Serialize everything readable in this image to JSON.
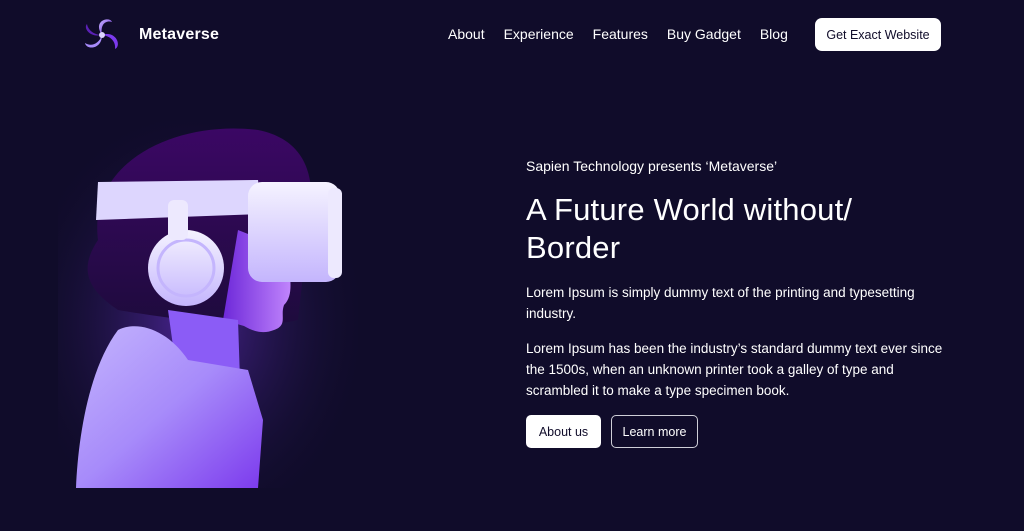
{
  "brand": {
    "name": "Metaverse",
    "logo_icon": "metaverse-swirl-logo"
  },
  "nav": {
    "items": [
      {
        "label": "About"
      },
      {
        "label": "Experience"
      },
      {
        "label": "Features"
      },
      {
        "label": "Buy Gadget"
      },
      {
        "label": "Blog"
      }
    ],
    "cta_label": "Get Exact Website"
  },
  "hero": {
    "eyebrow": "Sapien Technology presents ‘Metaverse’",
    "headline_line1": "A Future World without/",
    "headline_line2": "Border",
    "paragraph1": "Lorem Ipsum is simply dummy text of the printing and typesetting industry.",
    "paragraph2": "Lorem Ipsum has been the industry’s standard dummy text ever since the 1500s, when an unknown printer took a galley of type and scrambled it to make a type specimen book.",
    "primary_button": "About us",
    "secondary_button": "Learn more",
    "image": "person-wearing-vr-headset"
  },
  "colors": {
    "background": "#100c2a",
    "accent": "#8b5cf6",
    "text": "#ffffff"
  }
}
